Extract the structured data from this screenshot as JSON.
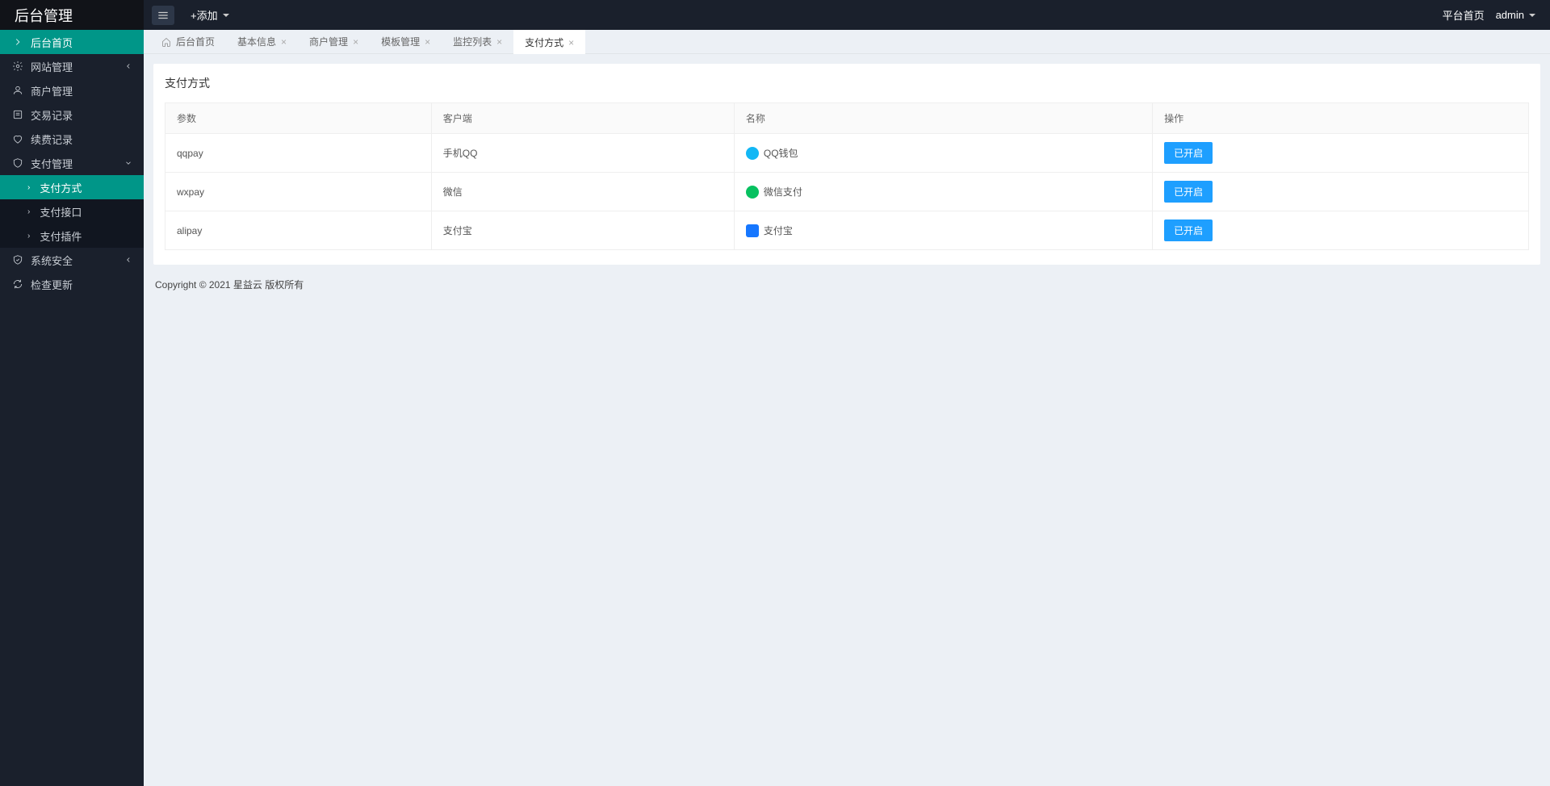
{
  "brand": "后台管理",
  "topbar": {
    "add_label": "+添加",
    "home_link": "平台首页",
    "user": "admin"
  },
  "sidebar": {
    "home": "后台首页",
    "site": "网站管理",
    "merchant": "商户管理",
    "trade": "交易记录",
    "renew": "续费记录",
    "pay": "支付管理",
    "pay_sub": {
      "method": "支付方式",
      "interface": "支付接口",
      "plugin": "支付插件"
    },
    "security": "系统安全",
    "update": "检查更新"
  },
  "tabs": {
    "home": "后台首页",
    "basic": "基本信息",
    "merchant": "商户管理",
    "template": "模板管理",
    "monitor": "监控列表",
    "pay_method": "支付方式"
  },
  "panel": {
    "title": "支付方式",
    "columns": {
      "param": "参数",
      "client": "客户端",
      "name": "名称",
      "action": "操作"
    },
    "rows": [
      {
        "param": "qqpay",
        "client": "手机QQ",
        "name": "QQ钱包",
        "icon": "qq",
        "action": "已开启"
      },
      {
        "param": "wxpay",
        "client": "微信",
        "name": "微信支付",
        "icon": "wx",
        "action": "已开启"
      },
      {
        "param": "alipay",
        "client": "支付宝",
        "name": "支付宝",
        "icon": "ali",
        "action": "已开启"
      }
    ]
  },
  "footer": "Copyright © 2021 星益云 版权所有"
}
